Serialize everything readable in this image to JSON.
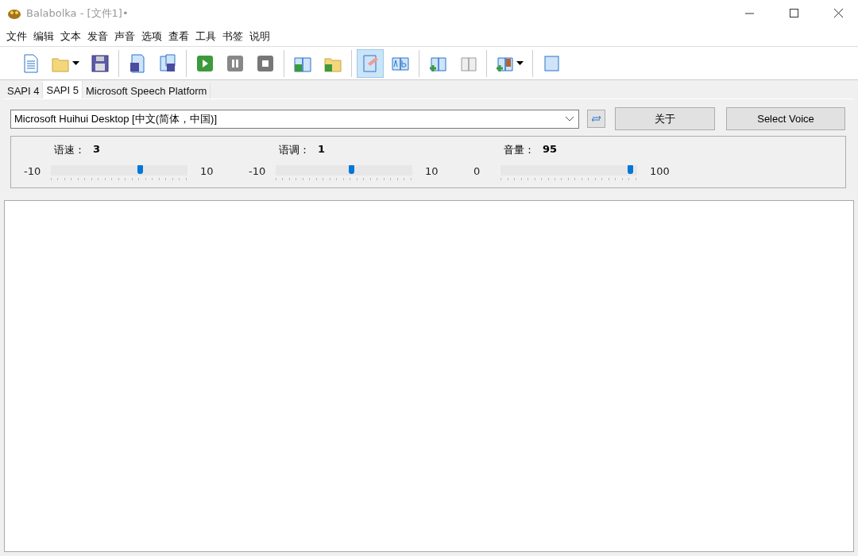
{
  "window": {
    "title": "Balabolka - [文件1]•"
  },
  "menu": [
    "文件",
    "编辑",
    "文本",
    "发音",
    "声音",
    "选项",
    "查看",
    "工具",
    "书签",
    "说明"
  ],
  "toolbar": [
    [
      {
        "selected": false,
        "has_menu": false
      },
      {
        "selected": false,
        "has_menu": true
      },
      {
        "selected": false,
        "has_menu": false
      }
    ],
    [
      {
        "selected": false,
        "has_menu": false
      },
      {
        "selected": false,
        "has_menu": false
      }
    ],
    [
      {
        "selected": false,
        "has_menu": false
      },
      {
        "selected": false,
        "has_menu": false
      },
      {
        "selected": false,
        "has_menu": false
      }
    ],
    [
      {
        "selected": false,
        "has_menu": false
      },
      {
        "selected": false,
        "has_menu": false
      }
    ],
    [
      {
        "selected": true,
        "has_menu": false
      },
      {
        "selected": false,
        "has_menu": false
      }
    ],
    [
      {
        "selected": false,
        "has_menu": false
      },
      {
        "selected": false,
        "has_menu": false
      }
    ],
    [
      {
        "selected": false,
        "has_menu": true
      }
    ],
    [
      {
        "selected": false,
        "has_menu": false
      }
    ]
  ],
  "tabs": [
    {
      "label": "SAPI 4",
      "selected": false
    },
    {
      "label": "SAPI 5",
      "selected": true
    },
    {
      "label": "Microsoft Speech Platform",
      "selected": false
    }
  ],
  "voice": {
    "value": "Microsoft Huihui Desktop [中文(简体，中国)]",
    "buttons": [
      "关于",
      "Select Voice"
    ]
  },
  "sliders": [
    {
      "label": "语速：",
      "reading": "3",
      "min": "-10",
      "max": "10",
      "level": 0.65
    },
    {
      "label": "语调：",
      "reading": "1",
      "min": "-10",
      "max": "10",
      "level": 0.55
    },
    {
      "label": "音量：",
      "reading": "95",
      "min": "0",
      "max": "100",
      "level": 0.95
    }
  ]
}
